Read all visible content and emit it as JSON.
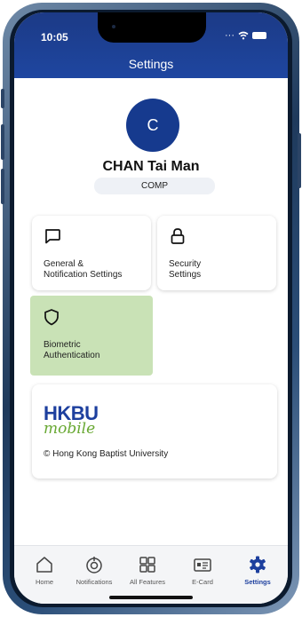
{
  "status_bar": {
    "time": "10:05"
  },
  "header": {
    "title": "Settings"
  },
  "profile": {
    "avatar_initial": "C",
    "name": "CHAN Tai Man",
    "department": "COMP"
  },
  "cards": [
    {
      "id": "general",
      "icon": "chat-bubble-icon",
      "label_lines": [
        "General &",
        "Notification Settings"
      ]
    },
    {
      "id": "security",
      "icon": "lock-icon",
      "label_lines": [
        "Security",
        "Settings"
      ]
    },
    {
      "id": "biometric",
      "icon": "shield-icon",
      "label_lines": [
        "Biometric",
        "Authentication"
      ],
      "highlighted": true
    }
  ],
  "about": {
    "logo_top": "HKBU",
    "logo_bottom": "mobile",
    "copyright": "© Hong Kong Baptist University"
  },
  "bottom_nav": [
    {
      "label": "Home",
      "icon": "home-icon"
    },
    {
      "label": "Notifications",
      "icon": "notification-icon"
    },
    {
      "label": "All Features",
      "icon": "grid-icon"
    },
    {
      "label": "E-Card",
      "icon": "ecard-icon"
    },
    {
      "label": "Settings",
      "icon": "gear-icon",
      "active": true
    }
  ],
  "colors": {
    "header": "#1e46a0",
    "accent": "#1d3f9e",
    "highlight": "#c9e2b6",
    "logo_green": "#68a832"
  }
}
